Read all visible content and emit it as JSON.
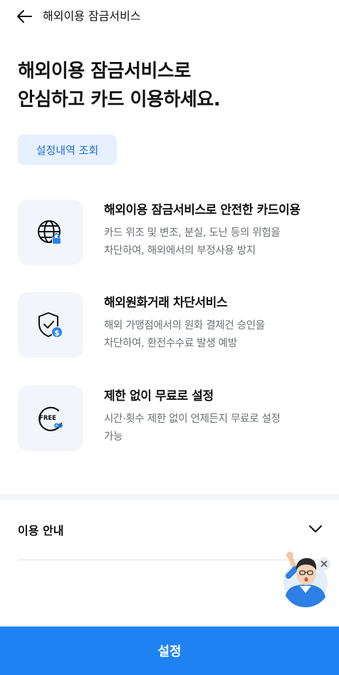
{
  "header": {
    "back_icon": "arrow-left-icon",
    "title": "해외이용 잠금서비스"
  },
  "hero": {
    "line1": "해외이용 잠금서비스로",
    "line2": "안심하고 카드 이용하세요."
  },
  "history_button": {
    "label": "설정내역 조회"
  },
  "features": [
    {
      "icon": "globe-lock-icon",
      "title": "해외이용 잠금서비스로 안전한 카드이용",
      "desc_line1": "카드 위조 및 변조, 분실, 도난 등의 위험을",
      "desc_line2": "차단하여, 해외에서의 부정사용 방지"
    },
    {
      "icon": "shield-dollar-icon",
      "title": "해외원화거래 차단서비스",
      "desc_line1": "해외 가맹점에서의 원화 결제건 승인을",
      "desc_line2": "차단하여, 환전수수료 발생 예방"
    },
    {
      "icon": "free-infinity-icon",
      "title": "제한 없이 무료로 설정",
      "desc_line1": "시간·횟수 제한 없이 언제든지 무료로 설정",
      "desc_line2": "가능",
      "badge_text": "FREE"
    }
  ],
  "guide": {
    "label": "이용 안내",
    "chevron_icon": "chevron-down-icon"
  },
  "chatbot": {
    "icon": "chatbot-character-icon",
    "close_icon": "close-icon"
  },
  "submit_button": {
    "label": "설정"
  },
  "colors": {
    "accent": "#1f82f2",
    "accent_text": "#1f6fd6",
    "chip_bg": "#e6f0fe",
    "icon_box_bg": "#f3f5fa",
    "desc_text": "#6b6f76"
  }
}
